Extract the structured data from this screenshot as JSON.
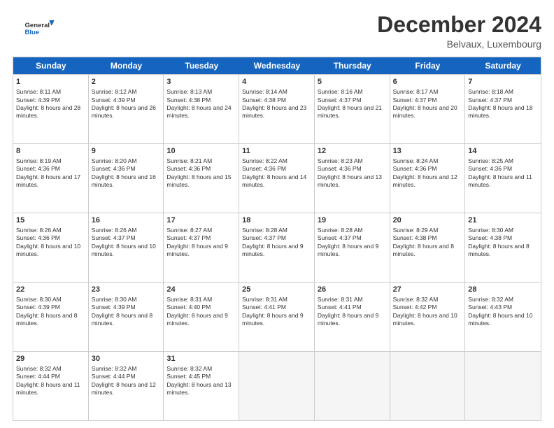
{
  "header": {
    "logo_line1": "General",
    "logo_line2": "Blue",
    "month": "December 2024",
    "location": "Belvaux, Luxembourg"
  },
  "days": [
    "Sunday",
    "Monday",
    "Tuesday",
    "Wednesday",
    "Thursday",
    "Friday",
    "Saturday"
  ],
  "weeks": [
    [
      {
        "day": 1,
        "sunrise": "8:11 AM",
        "sunset": "4:39 PM",
        "daylight": "8 hours and 28 minutes."
      },
      {
        "day": 2,
        "sunrise": "8:12 AM",
        "sunset": "4:39 PM",
        "daylight": "8 hours and 26 minutes."
      },
      {
        "day": 3,
        "sunrise": "8:13 AM",
        "sunset": "4:38 PM",
        "daylight": "8 hours and 24 minutes."
      },
      {
        "day": 4,
        "sunrise": "8:14 AM",
        "sunset": "4:38 PM",
        "daylight": "8 hours and 23 minutes."
      },
      {
        "day": 5,
        "sunrise": "8:16 AM",
        "sunset": "4:37 PM",
        "daylight": "8 hours and 21 minutes."
      },
      {
        "day": 6,
        "sunrise": "8:17 AM",
        "sunset": "4:37 PM",
        "daylight": "8 hours and 20 minutes."
      },
      {
        "day": 7,
        "sunrise": "8:18 AM",
        "sunset": "4:37 PM",
        "daylight": "8 hours and 18 minutes."
      }
    ],
    [
      {
        "day": 8,
        "sunrise": "8:19 AM",
        "sunset": "4:36 PM",
        "daylight": "8 hours and 17 minutes."
      },
      {
        "day": 9,
        "sunrise": "8:20 AM",
        "sunset": "4:36 PM",
        "daylight": "8 hours and 16 minutes."
      },
      {
        "day": 10,
        "sunrise": "8:21 AM",
        "sunset": "4:36 PM",
        "daylight": "8 hours and 15 minutes."
      },
      {
        "day": 11,
        "sunrise": "8:22 AM",
        "sunset": "4:36 PM",
        "daylight": "8 hours and 14 minutes."
      },
      {
        "day": 12,
        "sunrise": "8:23 AM",
        "sunset": "4:36 PM",
        "daylight": "8 hours and 13 minutes."
      },
      {
        "day": 13,
        "sunrise": "8:24 AM",
        "sunset": "4:36 PM",
        "daylight": "8 hours and 12 minutes."
      },
      {
        "day": 14,
        "sunrise": "8:25 AM",
        "sunset": "4:36 PM",
        "daylight": "8 hours and 11 minutes."
      }
    ],
    [
      {
        "day": 15,
        "sunrise": "8:26 AM",
        "sunset": "4:36 PM",
        "daylight": "8 hours and 10 minutes."
      },
      {
        "day": 16,
        "sunrise": "8:26 AM",
        "sunset": "4:37 PM",
        "daylight": "8 hours and 10 minutes."
      },
      {
        "day": 17,
        "sunrise": "8:27 AM",
        "sunset": "4:37 PM",
        "daylight": "8 hours and 9 minutes."
      },
      {
        "day": 18,
        "sunrise": "8:28 AM",
        "sunset": "4:37 PM",
        "daylight": "8 hours and 9 minutes."
      },
      {
        "day": 19,
        "sunrise": "8:28 AM",
        "sunset": "4:37 PM",
        "daylight": "8 hours and 9 minutes."
      },
      {
        "day": 20,
        "sunrise": "8:29 AM",
        "sunset": "4:38 PM",
        "daylight": "8 hours and 8 minutes."
      },
      {
        "day": 21,
        "sunrise": "8:30 AM",
        "sunset": "4:38 PM",
        "daylight": "8 hours and 8 minutes."
      }
    ],
    [
      {
        "day": 22,
        "sunrise": "8:30 AM",
        "sunset": "4:39 PM",
        "daylight": "8 hours and 8 minutes."
      },
      {
        "day": 23,
        "sunrise": "8:30 AM",
        "sunset": "4:39 PM",
        "daylight": "8 hours and 8 minutes."
      },
      {
        "day": 24,
        "sunrise": "8:31 AM",
        "sunset": "4:40 PM",
        "daylight": "8 hours and 9 minutes."
      },
      {
        "day": 25,
        "sunrise": "8:31 AM",
        "sunset": "4:41 PM",
        "daylight": "8 hours and 9 minutes."
      },
      {
        "day": 26,
        "sunrise": "8:31 AM",
        "sunset": "4:41 PM",
        "daylight": "8 hours and 9 minutes."
      },
      {
        "day": 27,
        "sunrise": "8:32 AM",
        "sunset": "4:42 PM",
        "daylight": "8 hours and 10 minutes."
      },
      {
        "day": 28,
        "sunrise": "8:32 AM",
        "sunset": "4:43 PM",
        "daylight": "8 hours and 10 minutes."
      }
    ],
    [
      {
        "day": 29,
        "sunrise": "8:32 AM",
        "sunset": "4:44 PM",
        "daylight": "8 hours and 11 minutes."
      },
      {
        "day": 30,
        "sunrise": "8:32 AM",
        "sunset": "4:44 PM",
        "daylight": "8 hours and 12 minutes."
      },
      {
        "day": 31,
        "sunrise": "8:32 AM",
        "sunset": "4:45 PM",
        "daylight": "8 hours and 13 minutes."
      },
      null,
      null,
      null,
      null
    ]
  ]
}
